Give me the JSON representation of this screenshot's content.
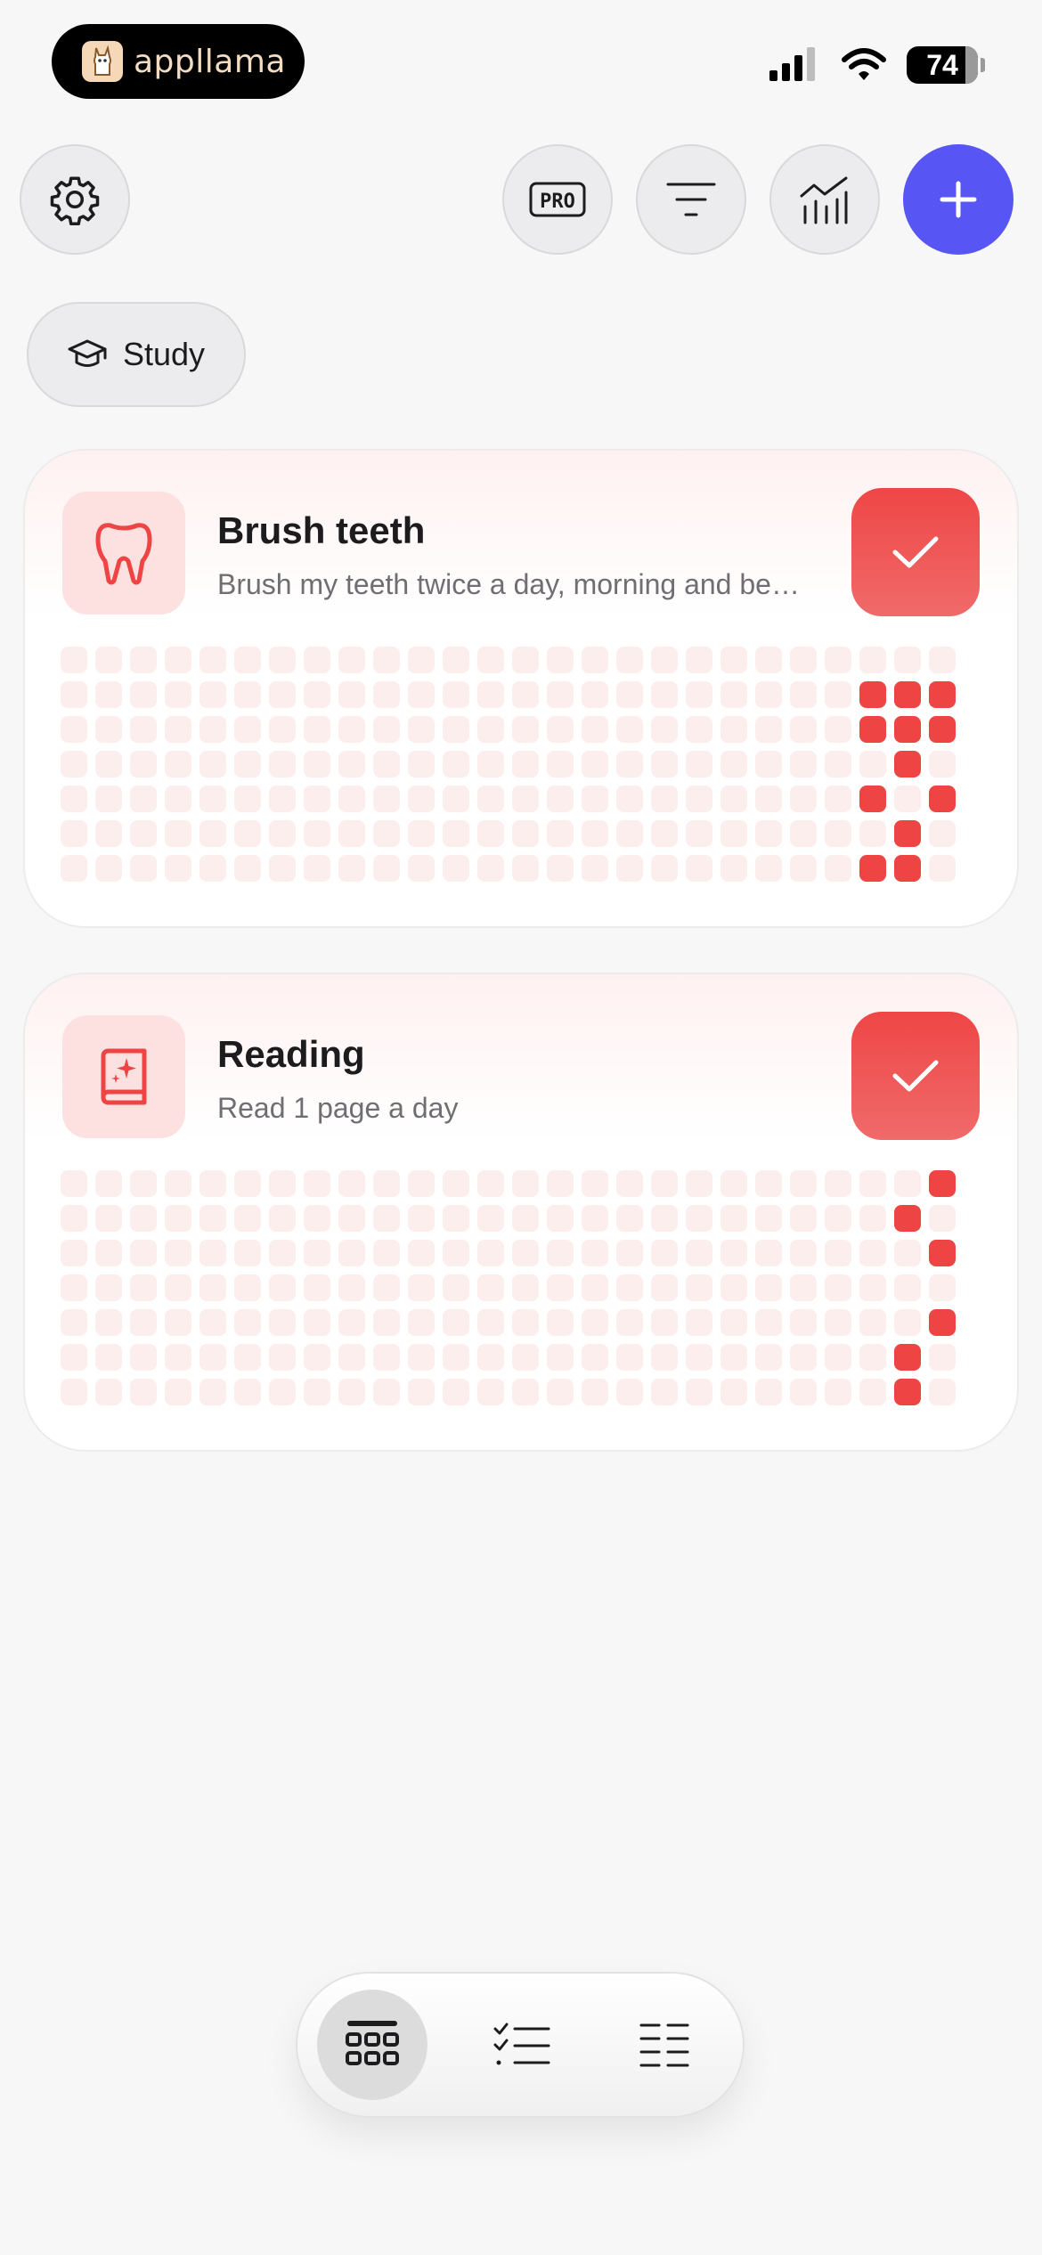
{
  "status_bar": {
    "app_brand": "appllama",
    "battery": "74"
  },
  "filters": {
    "study_label": "Study"
  },
  "habits": [
    {
      "title": "Brush teeth",
      "description": "Brush my teeth twice a day, morning and be…",
      "icon": "tooth-icon",
      "accent": "#ef4444"
    },
    {
      "title": "Reading",
      "description": "Read 1 page a day",
      "icon": "book-sparkle-icon",
      "accent": "#ef4444"
    }
  ],
  "colors": {
    "accent_red": "#ef4444",
    "primary_blue": "#5855f5"
  }
}
